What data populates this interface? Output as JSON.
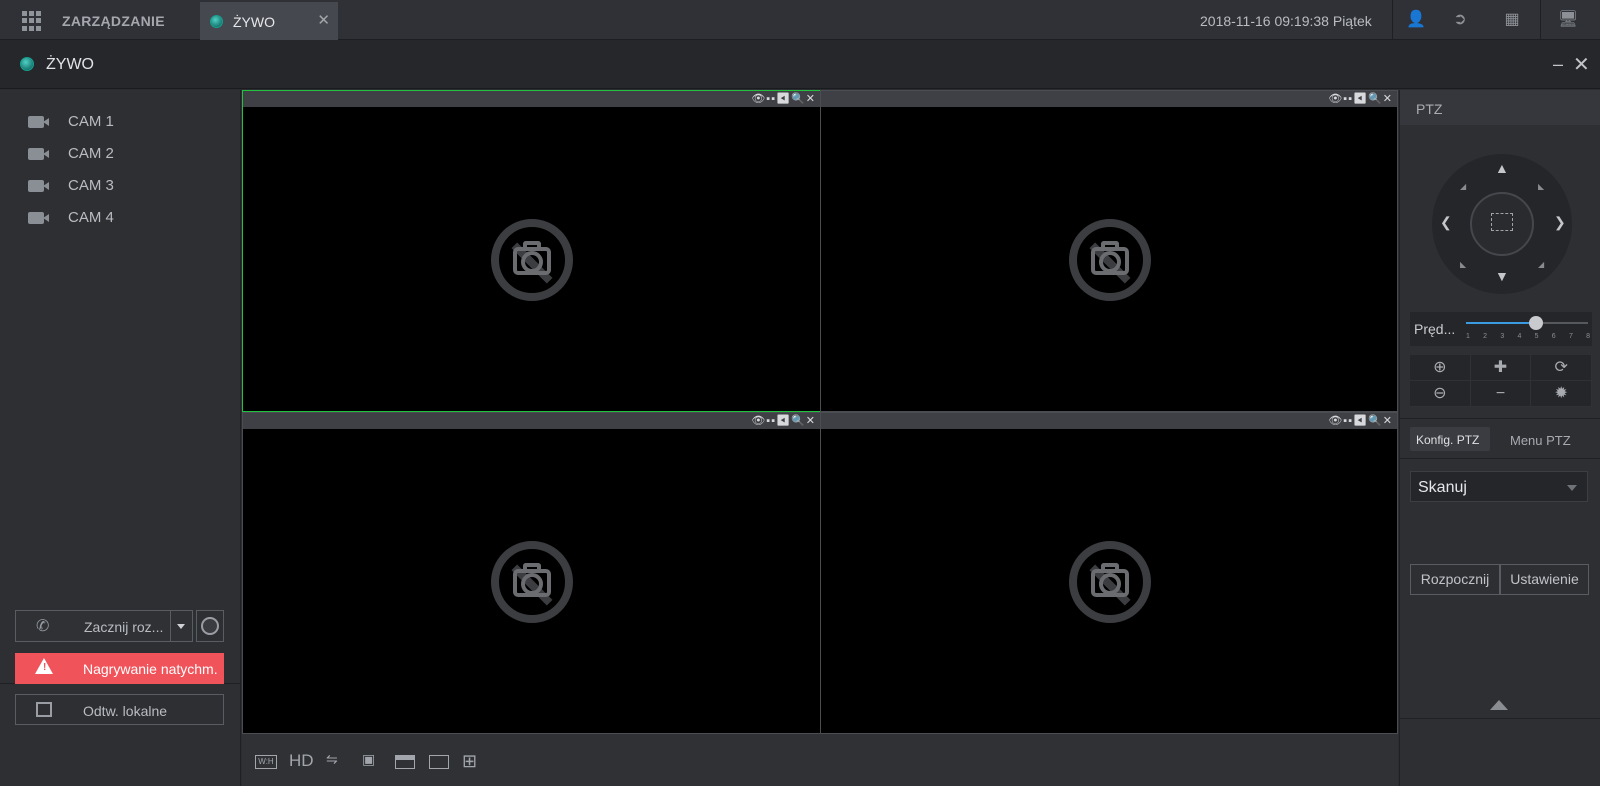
{
  "topbar": {
    "app_label": "ZARZĄDZANIE",
    "tab_label": "ŻYWO",
    "tab_close": "✕",
    "datetime": "2018-11-16 09:19:38 Piątek"
  },
  "titlebar": {
    "title": "ŻYWO",
    "minimize": "–",
    "close": "✕"
  },
  "cameras": [
    {
      "label": "CAM 1"
    },
    {
      "label": "CAM 2"
    },
    {
      "label": "CAM 3"
    },
    {
      "label": "CAM 4"
    }
  ],
  "actions": {
    "talk_label": "Zacznij roz...",
    "record_label": "Nagrywanie natychm.",
    "local_playback_label": "Odtw. lokalne"
  },
  "video_cells": [
    {
      "active": true
    },
    {
      "active": false
    },
    {
      "active": false
    },
    {
      "active": false
    }
  ],
  "cell_toolbar_icons": [
    "eye-icon",
    "record-icon",
    "snapshot-icon",
    "audio-icon",
    "zoom-icon",
    "close-icon"
  ],
  "cell_tools_glyphs": "👁▪▪◀🔍✕",
  "bottombar": {
    "wh_label": "W:H",
    "hd_label": "HD"
  },
  "ptz": {
    "header": "PTZ",
    "speed_label": "Pręd...",
    "speed_ticks": [
      "1",
      "2",
      "3",
      "4",
      "5",
      "6",
      "7",
      "8"
    ],
    "speed_value": 5,
    "tab_config": "Konfig. PTZ",
    "tab_menu": "Menu PTZ",
    "scan_select": "Skanuj",
    "start_button": "Rozpocznij",
    "settings_button": "Ustawienie"
  },
  "colors": {
    "active_border": "#23c23e",
    "record_button": "#f0535a",
    "slider_fill": "#3a9be0"
  }
}
